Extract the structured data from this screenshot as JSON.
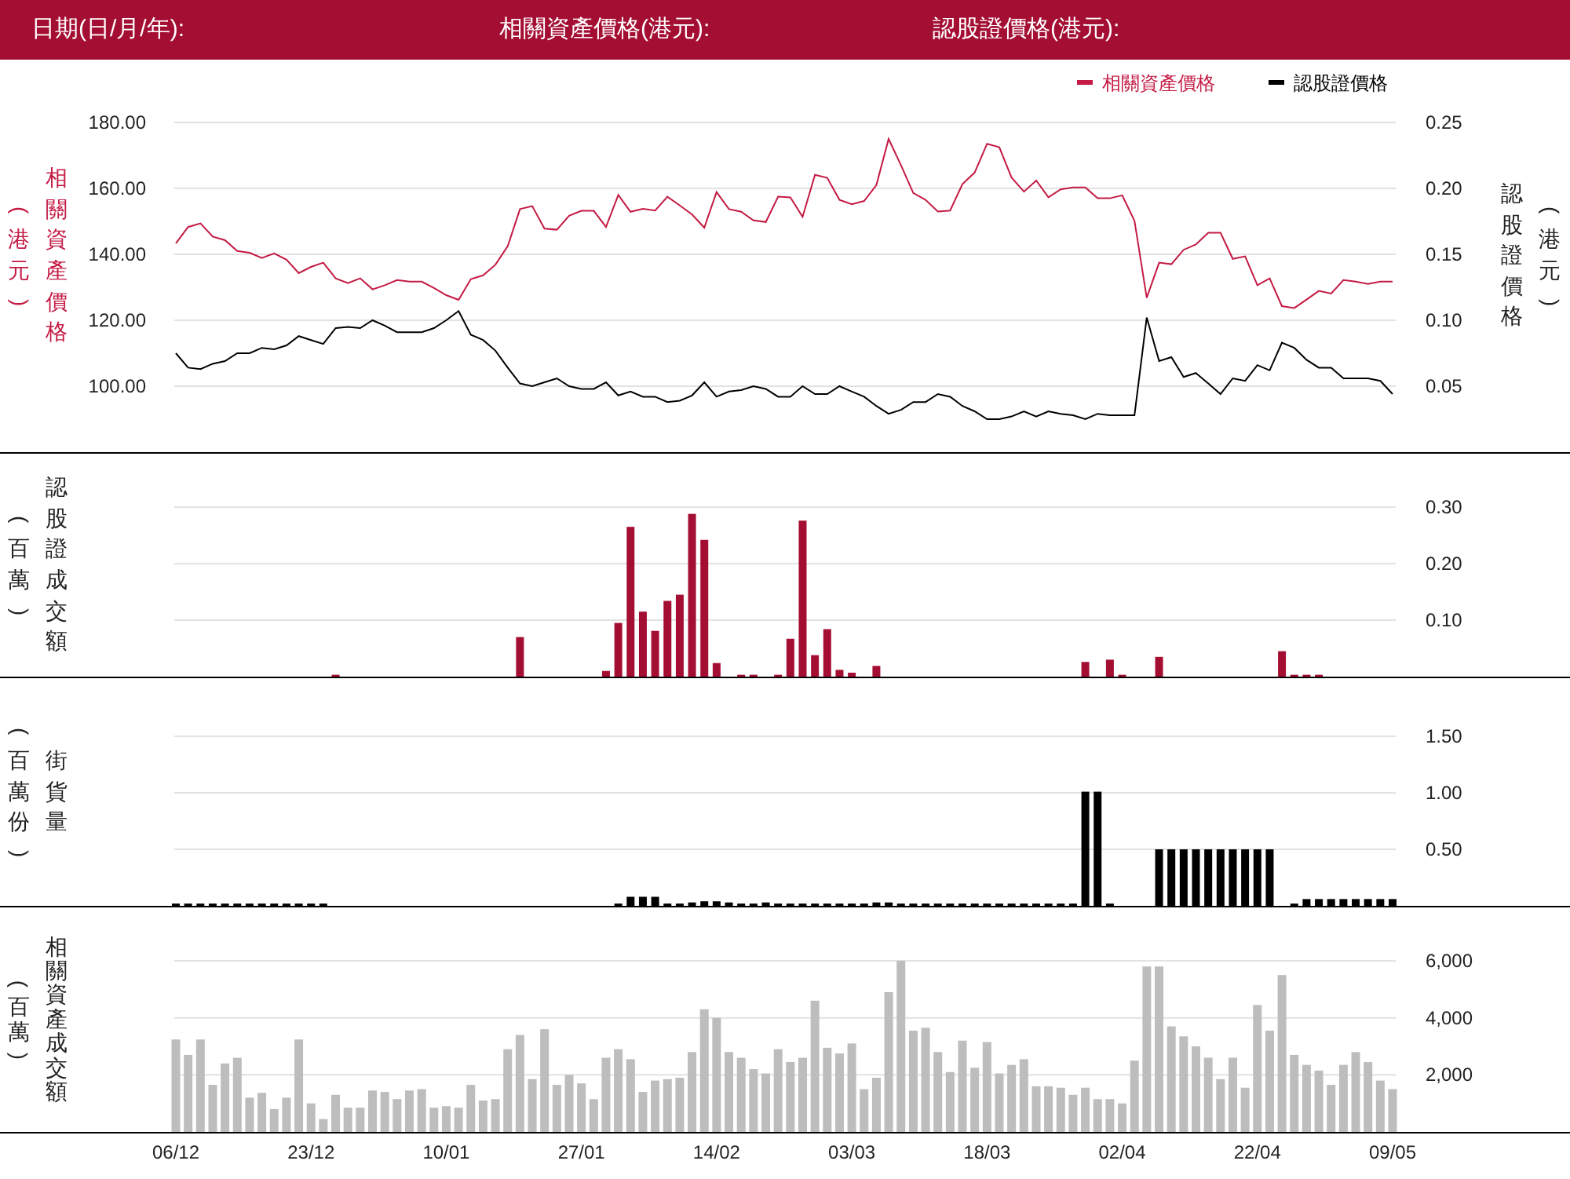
{
  "header": {
    "fields": [
      "日期(日/月/年):",
      "相關資產價格(港元):",
      "認股證價格(港元):"
    ]
  },
  "price_chart": {
    "left_unit": "(港元)",
    "right_unit": "(港元)",
    "chart_data": {
      "type": "line",
      "ylabel": "相關資產價格",
      "y2label": "認股證價格",
      "grid": true,
      "legend": true,
      "ylim": [
        80,
        180
      ],
      "y2lim": [
        0,
        0.25
      ],
      "yticks": [
        {
          "value": 180,
          "label": "180.00"
        },
        {
          "value": 160,
          "label": "160.00"
        },
        {
          "value": 140,
          "label": "140.00"
        },
        {
          "value": 120,
          "label": "120.00"
        },
        {
          "value": 100,
          "label": "100.00"
        }
      ],
      "y2ticks": [
        {
          "value": 0.25,
          "label": "0.25"
        },
        {
          "value": 0.2,
          "label": "0.20"
        },
        {
          "value": 0.15,
          "label": "0.15"
        },
        {
          "value": 0.1,
          "label": "0.10"
        },
        {
          "value": 0.05,
          "label": "0.05"
        }
      ],
      "series": [
        {
          "name": "相關資產價格",
          "color": "#c41a43",
          "values": [
            143.3,
            148.3,
            149.4,
            145.4,
            144.3,
            141,
            140.5,
            138.9,
            140.3,
            138.4,
            134.3,
            136.2,
            137.5,
            132.7,
            131.3,
            132.7,
            129.4,
            130.6,
            132.2,
            131.7,
            131.7,
            129.8,
            127.6,
            126.2,
            132.5,
            133.6,
            136.8,
            142.5,
            153.7,
            154.6,
            147.8,
            147.5,
            151.7,
            153.2,
            153.2,
            148.3,
            158,
            152.9,
            153.8,
            153.3,
            157.5,
            154.8,
            152.1,
            148.1,
            158.9,
            153.7,
            152.9,
            150.3,
            149.8,
            157.5,
            157.3,
            151.4,
            164.1,
            163.2,
            156.5,
            155.2,
            156.2,
            161,
            175,
            167,
            158.6,
            156.5,
            153,
            153.3,
            161.3,
            164.8,
            173.5,
            172.5,
            163.3,
            159,
            162.4,
            157.3,
            159.7,
            160.3,
            160.3,
            157,
            157,
            157.9,
            150.2,
            126.8,
            137.5,
            137,
            141.4,
            143,
            146.5,
            146.5,
            138.6,
            139.4,
            130.6,
            132.7,
            124.3,
            123.7,
            126.3,
            128.9,
            128.1,
            132.2,
            131.7,
            131,
            131.7,
            131.7
          ]
        },
        {
          "name": "認股證價格",
          "color": "#000000",
          "axis": "y2",
          "values": [
            0.075,
            0.064,
            0.063,
            0.067,
            0.069,
            0.075,
            0.075,
            0.079,
            0.078,
            0.081,
            0.088,
            0.085,
            0.082,
            0.094,
            0.095,
            0.094,
            0.1,
            0.096,
            0.091,
            0.091,
            0.091,
            0.094,
            0.1,
            0.107,
            0.089,
            0.085,
            0.077,
            0.064,
            0.052,
            0.05,
            0.053,
            0.056,
            0.05,
            0.048,
            0.048,
            0.053,
            0.043,
            0.046,
            0.042,
            0.042,
            0.038,
            0.039,
            0.043,
            0.053,
            0.042,
            0.046,
            0.047,
            0.05,
            0.048,
            0.042,
            0.042,
            0.05,
            0.044,
            0.044,
            0.05,
            0.046,
            0.042,
            0.035,
            0.029,
            0.032,
            0.038,
            0.038,
            0.044,
            0.042,
            0.035,
            0.031,
            0.025,
            0.025,
            0.027,
            0.031,
            0.027,
            0.031,
            0.029,
            0.028,
            0.025,
            0.029,
            0.028,
            0.028,
            0.028,
            0.102,
            0.069,
            0.072,
            0.057,
            0.06,
            0.052,
            0.044,
            0.056,
            0.054,
            0.066,
            0.062,
            0.083,
            0.079,
            0.07,
            0.064,
            0.064,
            0.056,
            0.056,
            0.056,
            0.054,
            0.044
          ]
        }
      ]
    }
  },
  "warrant_turnover_chart": {
    "unit": "(百萬)",
    "chart_data": {
      "type": "bar",
      "ylabel": "認股證成交額",
      "grid": true,
      "ylim": [
        0,
        0.3
      ],
      "yticks": [
        {
          "value": 0.3,
          "label": "0.30"
        },
        {
          "value": 0.2,
          "label": "0.20"
        },
        {
          "value": 0.1,
          "label": "0.10"
        }
      ],
      "series": [
        {
          "color": "#a50e33",
          "values": [
            0,
            0,
            0,
            0,
            0,
            0,
            0,
            0,
            0,
            0,
            0,
            0,
            0,
            0.002,
            0,
            0,
            0,
            0,
            0,
            0,
            0,
            0,
            0,
            0,
            0,
            0,
            0,
            0,
            0.07,
            0,
            0,
            0,
            0,
            0,
            0,
            0.01,
            0.095,
            0.265,
            0.115,
            0.081,
            0.134,
            0.145,
            0.288,
            0.242,
            0.024,
            0,
            0.003,
            0.003,
            0,
            0.003,
            0.067,
            0.276,
            0.038,
            0.084,
            0.012,
            0.007,
            0,
            0.019,
            0,
            0,
            0,
            0,
            0,
            0,
            0,
            0,
            0,
            0,
            0,
            0,
            0,
            0,
            0,
            0,
            0.026,
            0,
            0.03,
            0.003,
            0,
            0,
            0.035,
            0,
            0,
            0,
            0,
            0,
            0,
            0,
            0,
            0,
            0.045,
            0.003,
            0.003,
            0.003,
            0,
            0,
            0,
            0,
            0,
            0
          ]
        }
      ]
    }
  },
  "outstanding_chart": {
    "unit": "(百萬份)",
    "chart_data": {
      "type": "bar",
      "ylabel": "街貨量",
      "grid": true,
      "ylim": [
        0,
        1.5
      ],
      "yticks": [
        {
          "value": 1.5,
          "label": "1.50"
        },
        {
          "value": 1,
          "label": "1.00"
        },
        {
          "value": 0.5,
          "label": "0.50"
        }
      ],
      "series": [
        {
          "color": "#000000",
          "values": [
            0.02,
            0.02,
            0.02,
            0.02,
            0.02,
            0.02,
            0.02,
            0.02,
            0.02,
            0.02,
            0.02,
            0.02,
            0.02,
            0,
            0,
            0,
            0,
            0,
            0,
            0,
            0,
            0,
            0,
            0,
            0,
            0,
            0,
            0,
            0,
            0,
            0,
            0,
            0,
            0,
            0,
            0,
            0.02,
            0.08,
            0.08,
            0.08,
            0.02,
            0.02,
            0.03,
            0.04,
            0.04,
            0.03,
            0.02,
            0.02,
            0.03,
            0.02,
            0.02,
            0.02,
            0.02,
            0.02,
            0.02,
            0.02,
            0.02,
            0.03,
            0.03,
            0.02,
            0.02,
            0.02,
            0.02,
            0.02,
            0.02,
            0.02,
            0.02,
            0.02,
            0.02,
            0.02,
            0.02,
            0.02,
            0.02,
            0.02,
            1.01,
            1.01,
            0.02,
            0,
            0,
            0,
            0.5,
            0.5,
            0.5,
            0.5,
            0.5,
            0.5,
            0.5,
            0.5,
            0.5,
            0.5,
            0,
            0.02,
            0.06,
            0.06,
            0.06,
            0.06,
            0.06,
            0.06,
            0.06,
            0.06
          ]
        }
      ]
    }
  },
  "underlying_turnover_chart": {
    "unit": "(百萬)",
    "date_labels": [
      "06/12",
      "23/12",
      "10/01",
      "27/01",
      "14/02",
      "03/03",
      "18/03",
      "02/04",
      "22/04",
      "09/05"
    ],
    "chart_data": {
      "type": "bar",
      "ylabel": "相關資產成交額",
      "grid": true,
      "ylim": [
        0,
        6000
      ],
      "yticks": [
        {
          "value": 6000,
          "label": "6,000"
        },
        {
          "value": 4000,
          "label": "4,000"
        },
        {
          "value": 2000,
          "label": "2,000"
        }
      ],
      "series": [
        {
          "color": "#bdbdbd",
          "values": [
            3240,
            2700,
            3240,
            1650,
            2400,
            2600,
            1200,
            1370,
            800,
            1200,
            3240,
            1000,
            450,
            1300,
            850,
            850,
            1450,
            1400,
            1150,
            1450,
            1500,
            850,
            900,
            850,
            1650,
            1100,
            1150,
            2900,
            3400,
            1850,
            3600,
            1650,
            2000,
            1700,
            1150,
            2600,
            2900,
            2550,
            1400,
            1800,
            1850,
            1900,
            2800,
            4300,
            4000,
            2800,
            2600,
            2200,
            2050,
            2900,
            2450,
            2600,
            4600,
            2950,
            2750,
            3100,
            1500,
            1900,
            4900,
            6000,
            3550,
            3650,
            2800,
            2100,
            3200,
            2250,
            3150,
            2050,
            2350,
            2550,
            1600,
            1600,
            1550,
            1300,
            1550,
            1150,
            1150,
            1000,
            2500,
            5800,
            5800,
            3700,
            3350,
            3000,
            2600,
            1850,
            2600,
            1550,
            4450,
            3550,
            5500,
            2700,
            2350,
            2150,
            1650,
            2350,
            2800,
            2450,
            1800,
            1500
          ]
        }
      ]
    }
  }
}
